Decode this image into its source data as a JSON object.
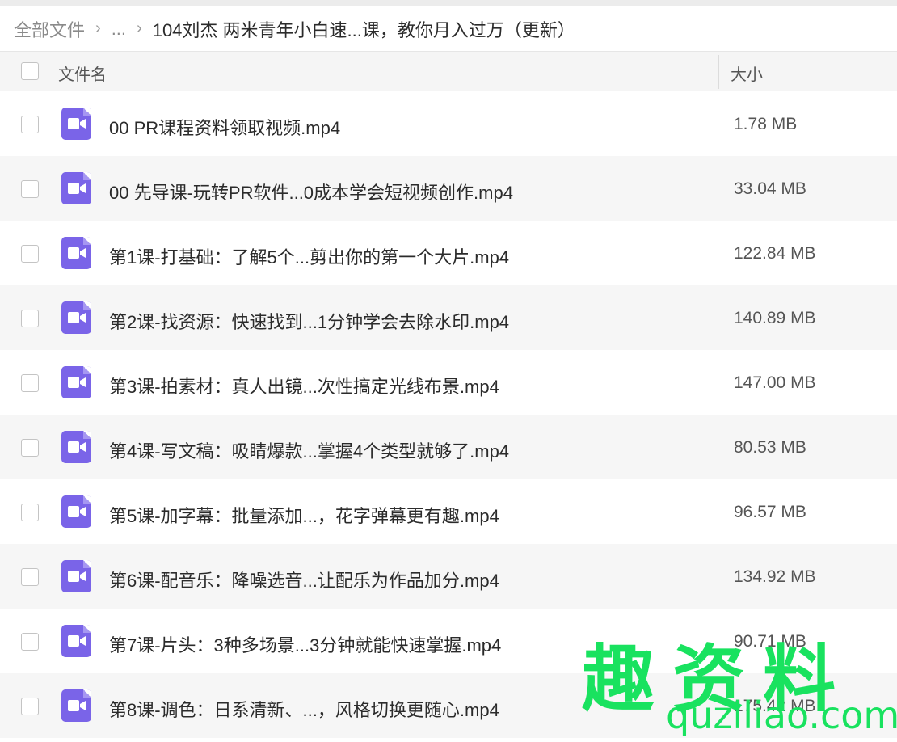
{
  "breadcrumb": {
    "root": "全部文件",
    "separator": "›",
    "ellipsis": "...",
    "current": "104刘杰 两米青年小白速...课，教你月入过万（更新）"
  },
  "header": {
    "name_label": "文件名",
    "size_label": "大小"
  },
  "files": [
    {
      "name": "00 PR课程资料领取视频.mp4",
      "size": "1.78 MB"
    },
    {
      "name": "00 先导课-玩转PR软件...0成本学会短视频创作.mp4",
      "size": "33.04 MB"
    },
    {
      "name": "第1课-打基础：了解5个...剪出你的第一个大片.mp4",
      "size": "122.84 MB"
    },
    {
      "name": "第2课-找资源：快速找到...1分钟学会去除水印.mp4",
      "size": "140.89 MB"
    },
    {
      "name": "第3课-拍素材：真人出镜...次性搞定光线布景.mp4",
      "size": "147.00 MB"
    },
    {
      "name": "第4课-写文稿：吸睛爆款...掌握4个类型就够了.mp4",
      "size": "80.53 MB"
    },
    {
      "name": "第5课-加字幕：批量添加...，花字弹幕更有趣.mp4",
      "size": "96.57 MB"
    },
    {
      "name": "第6课-配音乐：降噪选音...让配乐为作品加分.mp4",
      "size": "134.92 MB"
    },
    {
      "name": "第7课-片头：3种多场景...3分钟就能快速掌握.mp4",
      "size": "90.71 MB"
    },
    {
      "name": "第8课-调色：日系清新、...，风格切换更随心.mp4",
      "size": "175.42 MB"
    }
  ],
  "file_icon": "video-file-icon",
  "colors": {
    "icon_purple": "#7a64e8",
    "watermark_green": "#19e25f"
  },
  "watermark": {
    "text_cn": "趣资料",
    "text_url": "quziliao.com"
  }
}
